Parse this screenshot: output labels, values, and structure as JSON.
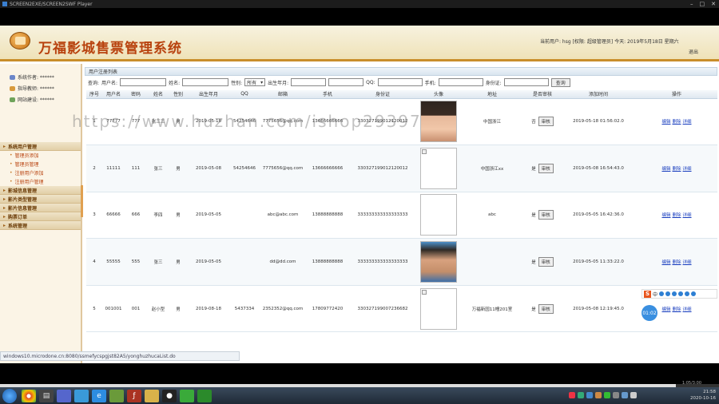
{
  "window": {
    "title": "SCREEN2EXE/SCREEN2SWF Player"
  },
  "header": {
    "app_title": "万福影城售票管理系统",
    "user_info": "当前用户: hsg [权限: 超级管理员] 今天: 2019年5月18日  星期六",
    "logout": "退出"
  },
  "sidebar": {
    "user_lines": [
      "系统作者: ******",
      "指导教师: ******",
      "网站建设: ******"
    ],
    "menu": [
      {
        "label": "系统用户管理",
        "items": [
          "管理员添加",
          "管理员管理",
          "注册用户添加",
          "注册用户管理"
        ]
      },
      {
        "label": "影城信息管理",
        "items": []
      },
      {
        "label": "影片类型管理",
        "items": []
      },
      {
        "label": "影片信息管理",
        "items": []
      },
      {
        "label": "购票订单",
        "items": []
      },
      {
        "label": "系统管理",
        "items": []
      }
    ]
  },
  "main": {
    "breadcrumb": "用户注册列表",
    "search": {
      "prefix": "查询:",
      "label_account": "用户名:",
      "label_name": "姓名:",
      "label_gender": "性别:",
      "gender_value": "所有",
      "label_birth": "出生年月:",
      "label_qq": "QQ:",
      "label_phone": "手机:",
      "label_idcard": "身份证:",
      "button": "查询"
    },
    "columns": [
      "序号",
      "用户名",
      "密码",
      "姓名",
      "性别",
      "出生年月",
      "QQ",
      "邮箱",
      "手机",
      "身份证",
      "头像",
      "地址",
      "是否审核",
      "添加时间",
      "操作"
    ],
    "audit_button": "审核",
    "ops": [
      "编辑",
      "删除",
      "详细"
    ],
    "rows": [
      {
        "no": "1",
        "account": "77777",
        "pwd": "777",
        "name": "张三三",
        "gender": "男",
        "birth": "2019-05-18",
        "qq": "54254646",
        "email": "7775656@qq.com",
        "phone": "13666666666",
        "idcard": "330327199012120012",
        "avatar": "face1",
        "address": "中国浙江",
        "audited": "否",
        "time": "2019-05-18 01:56:02.0"
      },
      {
        "no": "2",
        "account": "11111",
        "pwd": "111",
        "name": "张三",
        "gender": "男",
        "birth": "2019-05-08",
        "qq": "54254646",
        "email": "7775656@qq.com",
        "phone": "13666666666",
        "idcard": "330327199012120012",
        "avatar": "broken",
        "address": "中国浙江xx",
        "audited": "是",
        "time": "2019-05-08 16:54:43.0"
      },
      {
        "no": "3",
        "account": "66666",
        "pwd": "666",
        "name": "李四",
        "gender": "男",
        "birth": "2019-05-05",
        "qq": "",
        "email": "abc@abc.com",
        "phone": "13888888888",
        "idcard": "333333333333333333",
        "avatar": "empty",
        "address": "abc",
        "audited": "是",
        "time": "2019-05-05 16:42:36.0"
      },
      {
        "no": "4",
        "account": "55555",
        "pwd": "555",
        "name": "张三",
        "gender": "男",
        "birth": "2019-05-05",
        "qq": "",
        "email": "dd@dd.com",
        "phone": "13888888888",
        "idcard": "333333333333333333",
        "avatar": "face2",
        "address": "",
        "audited": "是",
        "time": "2019-05-05 11:33:22.0"
      },
      {
        "no": "5",
        "account": "001001",
        "pwd": "001",
        "name": "赵小型",
        "gender": "男",
        "birth": "2019-08-18",
        "qq": "5437334",
        "email": "2352352@qq.com",
        "phone": "17809772420",
        "idcard": "330327199007236682",
        "avatar": "broken",
        "address": "万福新园11幢201室",
        "audited": "是",
        "time": "2019-05-08 12:19:45.0"
      }
    ]
  },
  "status_url": "windows10.microdone.cn:8080/ssmefycspgjst82A5/yonghuzhucaList.do",
  "watermark": "https://www.huzhan.com/ishop29397",
  "ime": {
    "label": "中"
  },
  "floatball": "01:02",
  "player": {
    "time": "1:05/3:00",
    "progress": 0.94
  },
  "taskbar": {
    "clock_time": "21:58",
    "clock_date": "2020-10-16"
  }
}
